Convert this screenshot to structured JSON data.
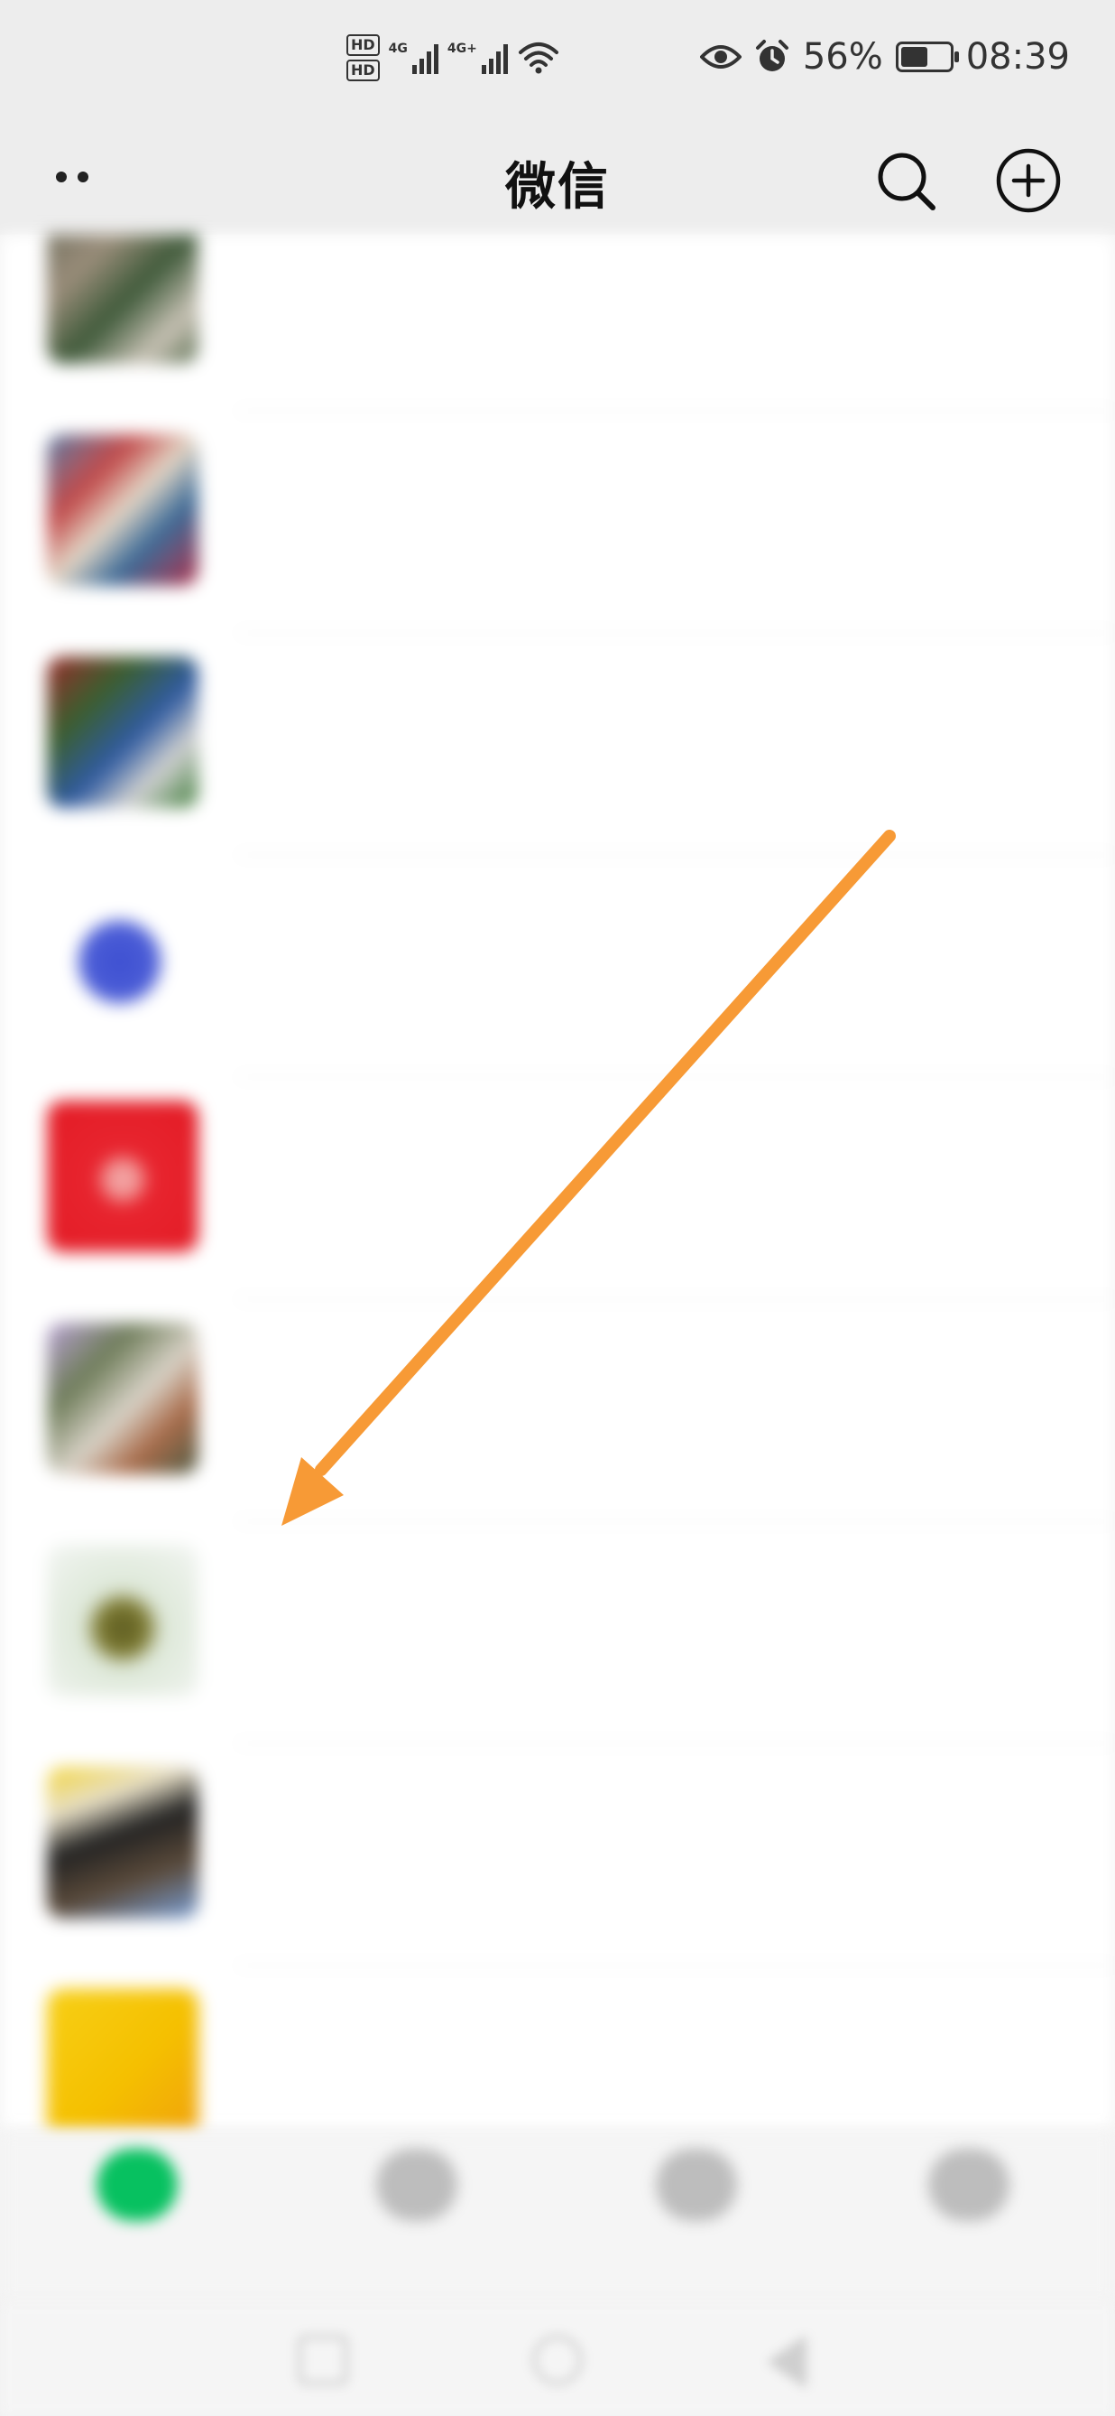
{
  "status_bar": {
    "hd1": "HD",
    "hd2": "HD",
    "net1": "4G",
    "net2": "4G+",
    "battery_text": "56%",
    "battery_level": 0.56,
    "time": "08:39",
    "icons": [
      "eye-icon",
      "alarm-icon",
      "wifi-icon",
      "battery-icon"
    ]
  },
  "nav": {
    "title": "微信",
    "icons": [
      "more-icon",
      "search-icon",
      "add-icon"
    ]
  },
  "chats": [
    {
      "name": "",
      "preview": "",
      "time": "",
      "mute": ""
    },
    {
      "name": "",
      "preview": "",
      "time": "",
      "mute": ""
    },
    {
      "name": "",
      "preview": "",
      "time": "",
      "mute": ""
    },
    {
      "name": "",
      "preview": "",
      "time": "",
      "mute": ""
    },
    {
      "name": "",
      "preview": "",
      "time": "",
      "mute": ""
    },
    {
      "name": "",
      "preview": "",
      "time": "",
      "mute": ""
    },
    {
      "name": "",
      "preview": "",
      "time": "",
      "mute": ""
    },
    {
      "name": "",
      "preview": "",
      "time": "",
      "mute": ""
    },
    {
      "name": "",
      "preview": "",
      "time": "",
      "mute": ""
    }
  ],
  "tabs": [
    {
      "label": ""
    },
    {
      "label": ""
    },
    {
      "label": ""
    },
    {
      "label": ""
    }
  ],
  "colors": {
    "wechat_green": "#07c160",
    "arrow_orange": "#f79a36",
    "header_bg": "#ededed"
  }
}
